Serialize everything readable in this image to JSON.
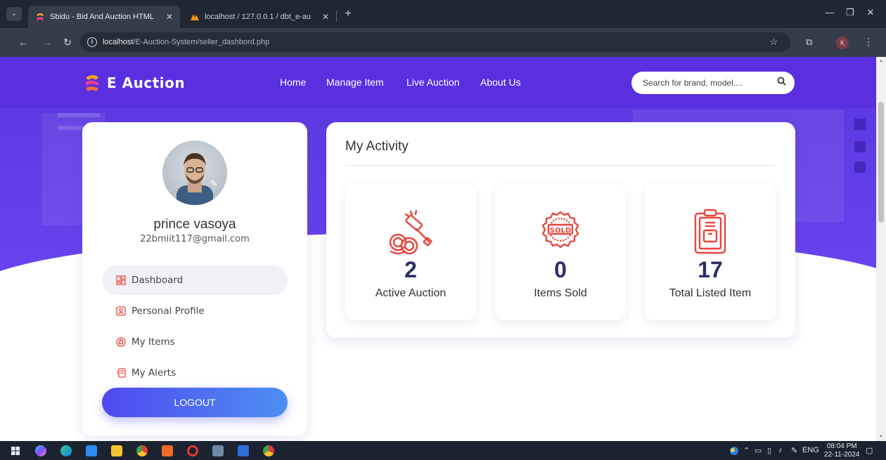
{
  "browser": {
    "tabs": [
      {
        "title": "Sbidu - Bid And Auction HTML",
        "favicon": "sbidu-logo-icon"
      },
      {
        "title": "localhost / 127.0.0.1 / dbt_e-au",
        "favicon": "phpmyadmin-icon"
      }
    ],
    "url_host": "localhost",
    "url_path": "/E-Auction-System/seller_dashbord.php",
    "profile_initial": "K"
  },
  "navbar": {
    "brand": "E Auction",
    "links": [
      "Home",
      "Manage Item",
      "Live Auction",
      "About Us"
    ],
    "search_placeholder": "Search for brand, model...."
  },
  "profile": {
    "name": "prince vasoya",
    "email": "22bmiit117@gmail.com",
    "menu": [
      {
        "label": "Dashboard",
        "icon": "dashboard-icon",
        "active": true
      },
      {
        "label": "Personal Profile",
        "icon": "profile-icon",
        "active": false
      },
      {
        "label": "My Items",
        "icon": "items-icon",
        "active": false
      },
      {
        "label": "My Alerts",
        "icon": "alerts-icon",
        "active": false
      }
    ],
    "logout_label": "LOGOUT"
  },
  "activity": {
    "title": "My Activity",
    "stats": [
      {
        "value": "2",
        "label": "Active Auction",
        "icon": "gavel-coins-icon"
      },
      {
        "value": "0",
        "label": "Items Sold",
        "icon": "sold-badge-icon"
      },
      {
        "value": "17",
        "label": "Total Listed Item",
        "icon": "clipboard-icon"
      }
    ]
  },
  "taskbar": {
    "language": "ENG",
    "time": "08:04 PM",
    "date": "22-11-2024"
  },
  "colors": {
    "brand_purple": "#5a2fe0",
    "accent_red": "#e8453c",
    "stat_value": "#2c2f66",
    "logout_gradient_start": "#4f49ef",
    "logout_gradient_end": "#4d8ff2"
  }
}
